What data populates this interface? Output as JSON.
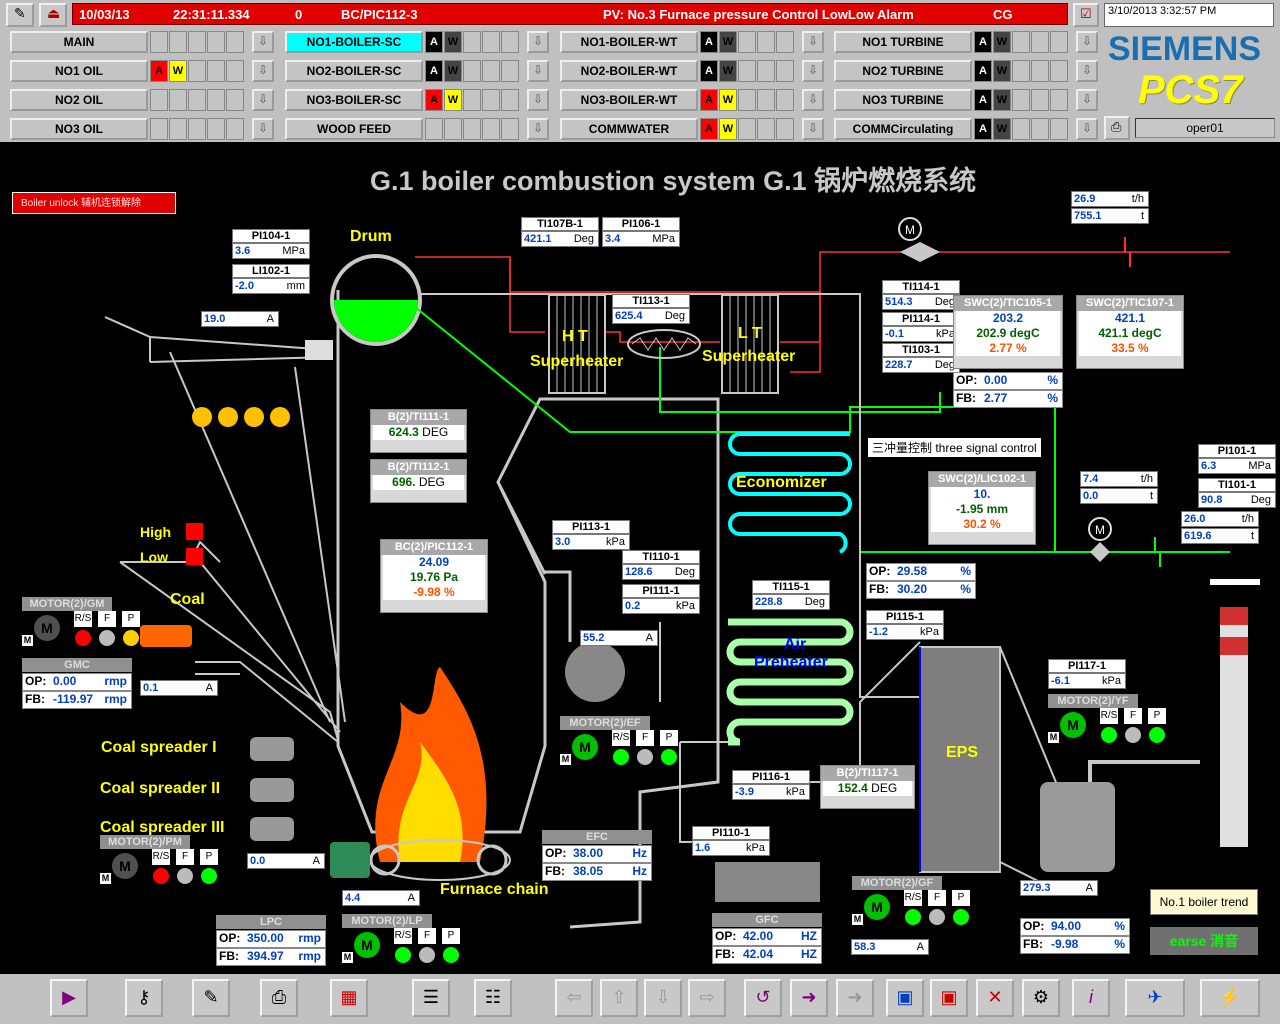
{
  "header": {
    "date": "10/03/13",
    "time": "22:31:11.334",
    "count": "0",
    "tag": "BC/PIC112-3",
    "message": "PV: No.3 Furnace pressure Control LowLow Alarm",
    "code": "CG",
    "clock": "3/10/2013 3:32:57 PM",
    "user": "oper01",
    "brand": "SIEMENS",
    "product": "PCS7"
  },
  "nav": [
    {
      "label": "MAIN",
      "a": "",
      "w": ""
    },
    {
      "label": "NO1-BOILER-SC",
      "a": "A",
      "w": "W",
      "selected": true
    },
    {
      "label": "NO1-BOILER-WT",
      "a": "A",
      "w": "W"
    },
    {
      "label": "NO1 TURBINE",
      "a": "A",
      "w": "W"
    },
    {
      "label": "NO1 OIL",
      "a": "A",
      "w": "W",
      "alarm": true
    },
    {
      "label": "NO2-BOILER-SC",
      "a": "A",
      "w": "W"
    },
    {
      "label": "NO2-BOILER-WT",
      "a": "A",
      "w": "W"
    },
    {
      "label": "NO2 TURBINE",
      "a": "A",
      "w": "W"
    },
    {
      "label": "NO2 OIL",
      "a": "",
      "w": ""
    },
    {
      "label": "NO3-BOILER-SC",
      "a": "A",
      "w": "W",
      "alarm": true
    },
    {
      "label": "NO3-BOILER-WT",
      "a": "A",
      "w": "W",
      "alarm": true
    },
    {
      "label": "NO3 TURBINE",
      "a": "A",
      "w": "W"
    },
    {
      "label": "NO3 OIL",
      "a": "",
      "w": ""
    },
    {
      "label": "WOOD FEED",
      "a": "",
      "w": ""
    },
    {
      "label": "COMMWATER",
      "a": "A",
      "w": "W",
      "alarm": true
    },
    {
      "label": "COMMCirculating",
      "a": "A",
      "w": "W"
    }
  ],
  "main": {
    "title": "G.1  boiler combustion system  G.1 锅炉燃烧系统",
    "unlock": "Boiler unlock 辅机连锁解除",
    "labels": {
      "drum": "Drum",
      "ht": "H T",
      "ht2": "Superheater",
      "lt": "L T",
      "lt2": "Superheater",
      "economizer": "Economizer",
      "air": "Air",
      "preheater": "Preheater",
      "eps": "EPS",
      "coal": "Coal",
      "high": "High",
      "low": "Low",
      "spreader1": "Coal spreader I",
      "spreader2": "Coal spreader II",
      "spreader3": "Coal spreader III",
      "furnace": "Furnace chain",
      "threesig": "三冲量控制  three signal control"
    },
    "instruments": {
      "pi104": {
        "tag": "PI104-1",
        "val": "3.6",
        "unit": "MPa"
      },
      "li102": {
        "tag": "LI102-1",
        "val": "-2.0",
        "unit": "mm"
      },
      "ti107b": {
        "tag": "TI107B-1",
        "val": "421.1",
        "unit": "Deg"
      },
      "pi106": {
        "tag": "PI106-1",
        "val": "3.4",
        "unit": "MPa"
      },
      "ti113": {
        "tag": "TI113-1",
        "val": "625.4",
        "unit": "Deg"
      },
      "ti114": {
        "tag": "TI114-1",
        "val": "514.3",
        "unit": "Deg"
      },
      "pi114": {
        "tag": "PI114-1",
        "val": "-0.1",
        "unit": "kPa"
      },
      "ti103": {
        "tag": "TI103-1",
        "val": "228.7",
        "unit": "Deg"
      },
      "flow1": {
        "val": "26.9",
        "unit": "t/h"
      },
      "flow1b": {
        "val": "755.1",
        "unit": "t"
      },
      "conv": {
        "val": "19.0",
        "unit": "A"
      },
      "pi113": {
        "tag": "PI113-1",
        "val": "3.0",
        "unit": "kPa"
      },
      "ti110": {
        "tag": "TI110-1",
        "val": "128.6",
        "unit": "Deg"
      },
      "pi111": {
        "tag": "PI111-1",
        "val": "0.2",
        "unit": "kPa"
      },
      "ti115": {
        "tag": "TI115-1",
        "val": "228.8",
        "unit": "Deg"
      },
      "pi115": {
        "tag": "PI115-1",
        "val": "-1.2",
        "unit": "kPa"
      },
      "pi101": {
        "tag": "PI101-1",
        "val": "6.3",
        "unit": "MPa"
      },
      "ti101": {
        "tag": "TI101-1",
        "val": "90.8",
        "unit": "Deg"
      },
      "flow2": {
        "val": "26.0",
        "unit": "t/h"
      },
      "flow2b": {
        "val": "619.6",
        "unit": "t"
      },
      "flow3": {
        "val": "7.4",
        "unit": "t/h"
      },
      "flow3b": {
        "val": "0.0",
        "unit": "t"
      },
      "pi117": {
        "tag": "PI117-1",
        "val": "-6.1",
        "unit": "kPa"
      },
      "pi116": {
        "tag": "PI116-1",
        "val": "-3.9",
        "unit": "kPa"
      },
      "pi110": {
        "tag": "PI110-1",
        "val": "1.6",
        "unit": "kPa"
      },
      "efAmp": {
        "val": "55.2",
        "unit": "A"
      },
      "gmAmp": {
        "val": "0.1",
        "unit": "A"
      },
      "pmAmp": {
        "val": "0.0",
        "unit": "A"
      },
      "lpAmp": {
        "val": "4.4",
        "unit": "A"
      },
      "gfAmp": {
        "val": "58.3",
        "unit": "A"
      },
      "yfAmp": {
        "val": "279.3",
        "unit": "A"
      }
    },
    "ti111": {
      "tag": "B(2)/TI111-1",
      "val": "624.3",
      "unit": "DEG"
    },
    "ti112": {
      "tag": "B(2)/TI112-1",
      "val": "696.",
      "unit": "DEG"
    },
    "ti117": {
      "tag": "B(2)/TI117-1",
      "val": "152.4",
      "unit": "DEG"
    },
    "pic112": {
      "tag": "BC(2)/PIC112-1",
      "sp": "24.09",
      "pv": "19.76 Pa",
      "out": "-9.98 %"
    },
    "tic105": {
      "tag": "SWC(2)/TIC105-1",
      "sp": "203.2",
      "pv": "202.9 degC",
      "out": "2.77 %"
    },
    "tic107": {
      "tag": "SWC(2)/TIC107-1",
      "sp": "421.1",
      "pv": "421.1 degC",
      "out": "33.5 %"
    },
    "lic102": {
      "tag": "SWC(2)/LIC102-1",
      "sp": "10.",
      "pv": "-1.95 mm",
      "out": "30.2 %"
    },
    "valve1": {
      "op": "0.00",
      "fb": "2.77",
      "unit": "%"
    },
    "valve2": {
      "op": "29.58",
      "fb": "30.20",
      "unit": "%"
    },
    "gmc": {
      "title": "GMC",
      "op": "0.00",
      "fb": "-119.97",
      "unit": "rmp"
    },
    "lpc": {
      "title": "LPC",
      "op": "350.00",
      "fb": "394.97",
      "unit": "rmp"
    },
    "efc": {
      "title": "EFC",
      "op": "38.00",
      "fb": "38.05",
      "unit": "Hz"
    },
    "gfc": {
      "title": "GFC",
      "op": "42.00",
      "fb": "42.04",
      "unit": "HZ"
    },
    "yfc": {
      "op": "94.00",
      "fb": "-9.98",
      "unit": "%"
    },
    "motors": {
      "gm": "MOTOR(2)/GM",
      "pm": "MOTOR(2)/PM",
      "lp": "MOTOR(2)/LP",
      "ef": "MOTOR(2)/EF",
      "gf": "MOTOR(2)/GF",
      "yf": "MOTOR(2)/YF"
    },
    "trend": "No.1 boiler trend",
    "erase": "earse 消音"
  },
  "colors": {
    "green": "#00ff00",
    "red": "#ff0000",
    "yellow": "#ffff00",
    "cyan": "#00ffff",
    "alarm": "#e00000"
  }
}
